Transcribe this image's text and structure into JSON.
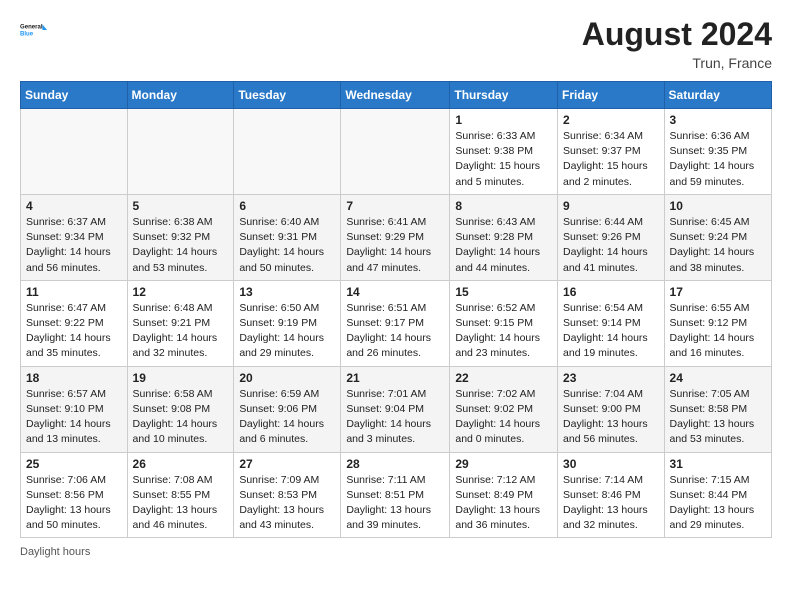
{
  "header": {
    "logo_line1": "General",
    "logo_line2": "Blue",
    "month_year": "August 2024",
    "location": "Trun, France"
  },
  "footer": {
    "label": "Daylight hours"
  },
  "days_of_week": [
    "Sunday",
    "Monday",
    "Tuesday",
    "Wednesday",
    "Thursday",
    "Friday",
    "Saturday"
  ],
  "weeks": [
    [
      {
        "day": "",
        "info": ""
      },
      {
        "day": "",
        "info": ""
      },
      {
        "day": "",
        "info": ""
      },
      {
        "day": "",
        "info": ""
      },
      {
        "day": "1",
        "info": "Sunrise: 6:33 AM\nSunset: 9:38 PM\nDaylight: 15 hours and 5 minutes."
      },
      {
        "day": "2",
        "info": "Sunrise: 6:34 AM\nSunset: 9:37 PM\nDaylight: 15 hours and 2 minutes."
      },
      {
        "day": "3",
        "info": "Sunrise: 6:36 AM\nSunset: 9:35 PM\nDaylight: 14 hours and 59 minutes."
      }
    ],
    [
      {
        "day": "4",
        "info": "Sunrise: 6:37 AM\nSunset: 9:34 PM\nDaylight: 14 hours and 56 minutes."
      },
      {
        "day": "5",
        "info": "Sunrise: 6:38 AM\nSunset: 9:32 PM\nDaylight: 14 hours and 53 minutes."
      },
      {
        "day": "6",
        "info": "Sunrise: 6:40 AM\nSunset: 9:31 PM\nDaylight: 14 hours and 50 minutes."
      },
      {
        "day": "7",
        "info": "Sunrise: 6:41 AM\nSunset: 9:29 PM\nDaylight: 14 hours and 47 minutes."
      },
      {
        "day": "8",
        "info": "Sunrise: 6:43 AM\nSunset: 9:28 PM\nDaylight: 14 hours and 44 minutes."
      },
      {
        "day": "9",
        "info": "Sunrise: 6:44 AM\nSunset: 9:26 PM\nDaylight: 14 hours and 41 minutes."
      },
      {
        "day": "10",
        "info": "Sunrise: 6:45 AM\nSunset: 9:24 PM\nDaylight: 14 hours and 38 minutes."
      }
    ],
    [
      {
        "day": "11",
        "info": "Sunrise: 6:47 AM\nSunset: 9:22 PM\nDaylight: 14 hours and 35 minutes."
      },
      {
        "day": "12",
        "info": "Sunrise: 6:48 AM\nSunset: 9:21 PM\nDaylight: 14 hours and 32 minutes."
      },
      {
        "day": "13",
        "info": "Sunrise: 6:50 AM\nSunset: 9:19 PM\nDaylight: 14 hours and 29 minutes."
      },
      {
        "day": "14",
        "info": "Sunrise: 6:51 AM\nSunset: 9:17 PM\nDaylight: 14 hours and 26 minutes."
      },
      {
        "day": "15",
        "info": "Sunrise: 6:52 AM\nSunset: 9:15 PM\nDaylight: 14 hours and 23 minutes."
      },
      {
        "day": "16",
        "info": "Sunrise: 6:54 AM\nSunset: 9:14 PM\nDaylight: 14 hours and 19 minutes."
      },
      {
        "day": "17",
        "info": "Sunrise: 6:55 AM\nSunset: 9:12 PM\nDaylight: 14 hours and 16 minutes."
      }
    ],
    [
      {
        "day": "18",
        "info": "Sunrise: 6:57 AM\nSunset: 9:10 PM\nDaylight: 14 hours and 13 minutes."
      },
      {
        "day": "19",
        "info": "Sunrise: 6:58 AM\nSunset: 9:08 PM\nDaylight: 14 hours and 10 minutes."
      },
      {
        "day": "20",
        "info": "Sunrise: 6:59 AM\nSunset: 9:06 PM\nDaylight: 14 hours and 6 minutes."
      },
      {
        "day": "21",
        "info": "Sunrise: 7:01 AM\nSunset: 9:04 PM\nDaylight: 14 hours and 3 minutes."
      },
      {
        "day": "22",
        "info": "Sunrise: 7:02 AM\nSunset: 9:02 PM\nDaylight: 14 hours and 0 minutes."
      },
      {
        "day": "23",
        "info": "Sunrise: 7:04 AM\nSunset: 9:00 PM\nDaylight: 13 hours and 56 minutes."
      },
      {
        "day": "24",
        "info": "Sunrise: 7:05 AM\nSunset: 8:58 PM\nDaylight: 13 hours and 53 minutes."
      }
    ],
    [
      {
        "day": "25",
        "info": "Sunrise: 7:06 AM\nSunset: 8:56 PM\nDaylight: 13 hours and 50 minutes."
      },
      {
        "day": "26",
        "info": "Sunrise: 7:08 AM\nSunset: 8:55 PM\nDaylight: 13 hours and 46 minutes."
      },
      {
        "day": "27",
        "info": "Sunrise: 7:09 AM\nSunset: 8:53 PM\nDaylight: 13 hours and 43 minutes."
      },
      {
        "day": "28",
        "info": "Sunrise: 7:11 AM\nSunset: 8:51 PM\nDaylight: 13 hours and 39 minutes."
      },
      {
        "day": "29",
        "info": "Sunrise: 7:12 AM\nSunset: 8:49 PM\nDaylight: 13 hours and 36 minutes."
      },
      {
        "day": "30",
        "info": "Sunrise: 7:14 AM\nSunset: 8:46 PM\nDaylight: 13 hours and 32 minutes."
      },
      {
        "day": "31",
        "info": "Sunrise: 7:15 AM\nSunset: 8:44 PM\nDaylight: 13 hours and 29 minutes."
      }
    ]
  ]
}
